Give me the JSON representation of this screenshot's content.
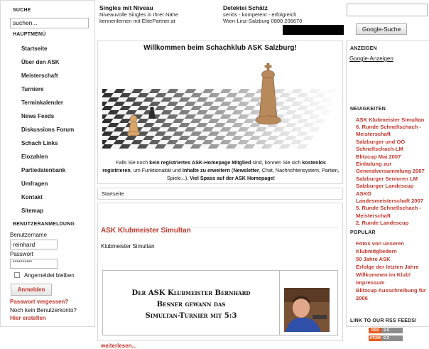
{
  "left": {
    "search_header": "SUCHE",
    "search_value": "suchen...",
    "main_menu_header": "HAUPTMENÜ",
    "menu_items": [
      "Startseite",
      "Über den ASK",
      "Meisterschaft",
      "Turniere",
      "Terminkalender",
      "News Feeds",
      "Diskussions Forum",
      "Schach Links",
      "Elozahlen",
      "Partiedatenbank",
      "Umfragen",
      "Kontakt",
      "Sitemap"
    ],
    "login_header": "BENUTZERANMELDUNG",
    "username_label": "Benutzername",
    "username_value": "reinhard",
    "password_label": "Passwort",
    "password_value": "**********",
    "remember_label": "Angemeldet bleiben",
    "login_button": "Anmelden",
    "forgot_password": "Passwort vergessen?",
    "no_account": "Noch kein Benutzerkonto?",
    "register": "Hier erstellen"
  },
  "ads": {
    "ad1_title": "Singles mit Niveau",
    "ad1_line1": "Niveauvolle Singles in Ihrer Nähe",
    "ad1_line2": "kennenlernen mit ElitePartner.at",
    "ad2_title": "Detektei Schätz",
    "ad2_line1": "seriös - kompetent - erfolgreich",
    "ad2_line2": "Wien-Linz-Salzburg 0800 206670"
  },
  "welcome": {
    "title": "Willkommen beim Schachklub ASK Salzburg!",
    "text_pre": "Falls Sie noch ",
    "text_b1": "kein registriertes ASK-Homepage Mitglied",
    "text_mid1": " sind, können Sie sich ",
    "text_b2": "kostenlos registrieren",
    "text_mid2": ", um Funktionaität und ",
    "text_b3": "Inhalte zu erweitern",
    "text_mid3": " (",
    "text_b4": "Newsletter",
    "text_mid4": ", Chat, Nachrichtensystem, Partien, Spiele...). ",
    "text_b5": "Viel Spass auf der ASK Homepage!"
  },
  "breadcrumb": "Startseite",
  "article": {
    "title": "ASK Klubmeister Simultan",
    "subtitle": "Klubmeister Simultan",
    "banner_line1": "Der ASK Klubmeister Bernhard",
    "banner_line2": "Besner gewann das",
    "banner_line3": "Simultan-Turnier mit 5:3",
    "read_more": "weiterlesen..."
  },
  "right": {
    "google_button": "Google-Suche",
    "ads_header": "ANZEIGEN",
    "google_ads_link": "Google-Anzeigen",
    "news_header": "NEUIGKEITEN",
    "news_items": [
      "ASK Klubmeister Simultan",
      "6. Runde Schnellschach -",
      "Meisterschaft",
      "Salzburger und OÖ",
      "Schnellschach-LM",
      "Blitzcup Mai 2007",
      "Einladung zur",
      "Generalversammlung 2007",
      "Salzburger Senioren LM",
      "Salzburger Landescup",
      "ASKÖ",
      "Landesmeisterschaft 2007",
      "5. Runde Schnellschach -",
      "Meisterschaft",
      "2. Runde Landescup"
    ],
    "popular_header": "POPULÄR",
    "popular_items": [
      "Fotos von unseren",
      "Klubmitgliedern",
      "50 Jahre ASK",
      "Erfolge der letzten Jahre",
      "Willkommen im Klub!",
      "Impressum",
      "Blitzcup Ausschreibung für",
      "2006"
    ],
    "rss_header": "LINK TO OUR RSS FEEDS!",
    "rss_label": "RSS",
    "rss_version": "2.0",
    "atom_label": "ATOM",
    "atom_version": "0.3"
  },
  "colors": {
    "accent": "#c2372c",
    "border": "#d8d8d8"
  }
}
